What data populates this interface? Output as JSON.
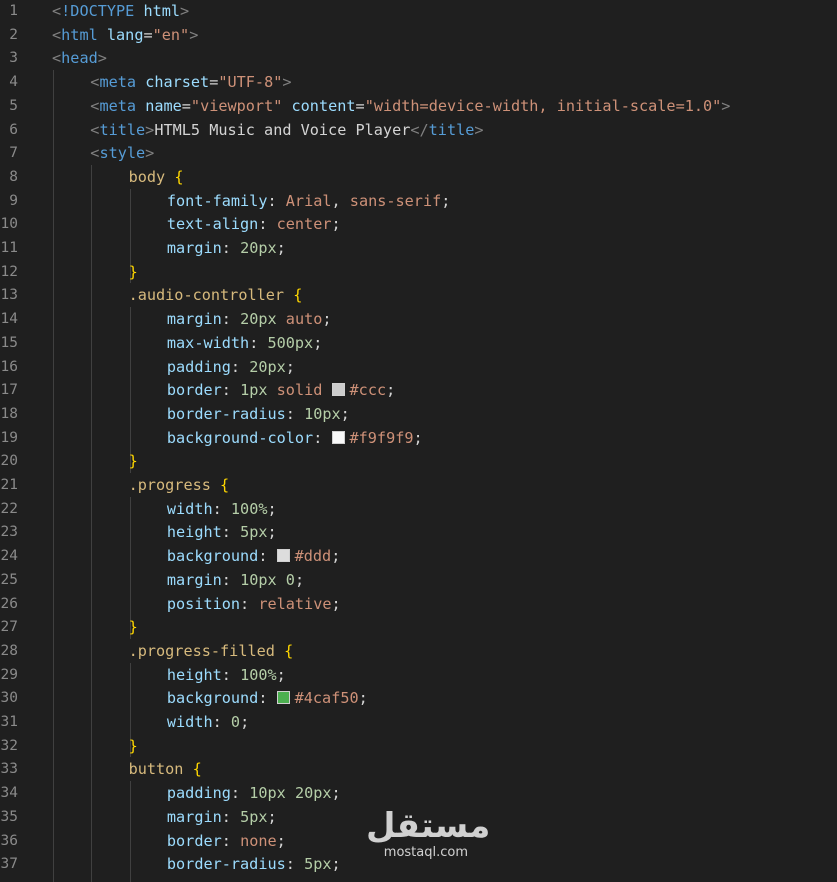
{
  "editor": {
    "line_numbers": [
      "1",
      "2",
      "3",
      "4",
      "5",
      "6",
      "7",
      "8",
      "9",
      "10",
      "11",
      "12",
      "13",
      "14",
      "15",
      "16",
      "17",
      "18",
      "19",
      "20",
      "21",
      "22",
      "23",
      "24",
      "25",
      "26",
      "27",
      "28",
      "29",
      "30",
      "31",
      "32",
      "33",
      "34",
      "35",
      "36",
      "37"
    ],
    "colors": {
      "background": "#1f1f1f",
      "line_number": "#8a8a8a",
      "tag": "#569cd6",
      "attribute": "#9cdcfe",
      "string": "#ce9178",
      "selector": "#d7ba7d",
      "number": "#b5cea8",
      "bracket": "#ffd700"
    },
    "lines": [
      [
        [
          "t-br",
          "<"
        ],
        [
          "t-tag",
          "!DOCTYPE"
        ],
        [
          "t-text",
          " "
        ],
        [
          "t-attr",
          "html"
        ],
        [
          "t-br",
          ">"
        ]
      ],
      [
        [
          "t-br",
          "<"
        ],
        [
          "t-tag",
          "html"
        ],
        [
          "t-text",
          " "
        ],
        [
          "t-attr",
          "lang"
        ],
        [
          "t-punc",
          "="
        ],
        [
          "t-str",
          "\"en\""
        ],
        [
          "t-br",
          ">"
        ]
      ],
      [
        [
          "t-br",
          "<"
        ],
        [
          "t-tag",
          "head"
        ],
        [
          "t-br",
          ">"
        ]
      ],
      [
        [
          "t-br",
          "<"
        ],
        [
          "t-tag",
          "meta"
        ],
        [
          "t-text",
          " "
        ],
        [
          "t-attr",
          "charset"
        ],
        [
          "t-punc",
          "="
        ],
        [
          "t-str",
          "\"UTF-8\""
        ],
        [
          "t-br",
          ">"
        ]
      ],
      [
        [
          "t-br",
          "<"
        ],
        [
          "t-tag",
          "meta"
        ],
        [
          "t-text",
          " "
        ],
        [
          "t-attr",
          "name"
        ],
        [
          "t-punc",
          "="
        ],
        [
          "t-str",
          "\"viewport\""
        ],
        [
          "t-text",
          " "
        ],
        [
          "t-attr",
          "content"
        ],
        [
          "t-punc",
          "="
        ],
        [
          "t-str",
          "\"width=device-width, initial-scale=1.0\""
        ],
        [
          "t-br",
          ">"
        ]
      ],
      [
        [
          "t-br",
          "<"
        ],
        [
          "t-tag",
          "title"
        ],
        [
          "t-br",
          ">"
        ],
        [
          "t-text",
          "HTML5 Music and Voice Player"
        ],
        [
          "t-br",
          "</"
        ],
        [
          "t-tag",
          "title"
        ],
        [
          "t-br",
          ">"
        ]
      ],
      [
        [
          "t-br",
          "<"
        ],
        [
          "t-tag",
          "style"
        ],
        [
          "t-br",
          ">"
        ]
      ],
      [
        [
          "t-sel",
          "body"
        ],
        [
          "t-text",
          " "
        ],
        [
          "t-cur",
          "{"
        ]
      ],
      [
        [
          "t-prop",
          "font-family"
        ],
        [
          "t-punc",
          ": "
        ],
        [
          "t-kw",
          "Arial"
        ],
        [
          "t-punc",
          ", "
        ],
        [
          "t-kw",
          "sans-serif"
        ],
        [
          "t-punc",
          ";"
        ]
      ],
      [
        [
          "t-prop",
          "text-align"
        ],
        [
          "t-punc",
          ": "
        ],
        [
          "t-kw",
          "center"
        ],
        [
          "t-punc",
          ";"
        ]
      ],
      [
        [
          "t-prop",
          "margin"
        ],
        [
          "t-punc",
          ": "
        ],
        [
          "t-num",
          "20px"
        ],
        [
          "t-punc",
          ";"
        ]
      ],
      [
        [
          "t-cur",
          "}"
        ]
      ],
      [
        [
          "t-sel",
          ".audio-controller"
        ],
        [
          "t-text",
          " "
        ],
        [
          "t-cur",
          "{"
        ]
      ],
      [
        [
          "t-prop",
          "margin"
        ],
        [
          "t-punc",
          ": "
        ],
        [
          "t-num",
          "20px"
        ],
        [
          "t-text",
          " "
        ],
        [
          "t-kw",
          "auto"
        ],
        [
          "t-punc",
          ";"
        ]
      ],
      [
        [
          "t-prop",
          "max-width"
        ],
        [
          "t-punc",
          ": "
        ],
        [
          "t-num",
          "500px"
        ],
        [
          "t-punc",
          ";"
        ]
      ],
      [
        [
          "t-prop",
          "padding"
        ],
        [
          "t-punc",
          ": "
        ],
        [
          "t-num",
          "20px"
        ],
        [
          "t-punc",
          ";"
        ]
      ],
      [
        [
          "t-prop",
          "border"
        ],
        [
          "t-punc",
          ": "
        ],
        [
          "t-num",
          "1px"
        ],
        [
          "t-text",
          " "
        ],
        [
          "t-kw",
          "solid"
        ],
        [
          "t-text",
          " "
        ],
        [
          "swatch",
          "#cccccc"
        ],
        [
          "t-kw",
          "#ccc"
        ],
        [
          "t-punc",
          ";"
        ]
      ],
      [
        [
          "t-prop",
          "border-radius"
        ],
        [
          "t-punc",
          ": "
        ],
        [
          "t-num",
          "10px"
        ],
        [
          "t-punc",
          ";"
        ]
      ],
      [
        [
          "t-prop",
          "background-color"
        ],
        [
          "t-punc",
          ": "
        ],
        [
          "swatch",
          "#f9f9f9"
        ],
        [
          "t-kw",
          "#f9f9f9"
        ],
        [
          "t-punc",
          ";"
        ]
      ],
      [
        [
          "t-cur",
          "}"
        ]
      ],
      [
        [
          "t-sel",
          ".progress"
        ],
        [
          "t-text",
          " "
        ],
        [
          "t-cur",
          "{"
        ]
      ],
      [
        [
          "t-prop",
          "width"
        ],
        [
          "t-punc",
          ": "
        ],
        [
          "t-num",
          "100%"
        ],
        [
          "t-punc",
          ";"
        ]
      ],
      [
        [
          "t-prop",
          "height"
        ],
        [
          "t-punc",
          ": "
        ],
        [
          "t-num",
          "5px"
        ],
        [
          "t-punc",
          ";"
        ]
      ],
      [
        [
          "t-prop",
          "background"
        ],
        [
          "t-punc",
          ": "
        ],
        [
          "swatch",
          "#dddddd"
        ],
        [
          "t-kw",
          "#ddd"
        ],
        [
          "t-punc",
          ";"
        ]
      ],
      [
        [
          "t-prop",
          "margin"
        ],
        [
          "t-punc",
          ": "
        ],
        [
          "t-num",
          "10px"
        ],
        [
          "t-text",
          " "
        ],
        [
          "t-num",
          "0"
        ],
        [
          "t-punc",
          ";"
        ]
      ],
      [
        [
          "t-prop",
          "position"
        ],
        [
          "t-punc",
          ": "
        ],
        [
          "t-kw",
          "relative"
        ],
        [
          "t-punc",
          ";"
        ]
      ],
      [
        [
          "t-cur",
          "}"
        ]
      ],
      [
        [
          "t-sel",
          ".progress-filled"
        ],
        [
          "t-text",
          " "
        ],
        [
          "t-cur",
          "{"
        ]
      ],
      [
        [
          "t-prop",
          "height"
        ],
        [
          "t-punc",
          ": "
        ],
        [
          "t-num",
          "100%"
        ],
        [
          "t-punc",
          ";"
        ]
      ],
      [
        [
          "t-prop",
          "background"
        ],
        [
          "t-punc",
          ": "
        ],
        [
          "swatch",
          "#4caf50"
        ],
        [
          "t-kw",
          "#4caf50"
        ],
        [
          "t-punc",
          ";"
        ]
      ],
      [
        [
          "t-prop",
          "width"
        ],
        [
          "t-punc",
          ": "
        ],
        [
          "t-num",
          "0"
        ],
        [
          "t-punc",
          ";"
        ]
      ],
      [
        [
          "t-cur",
          "}"
        ]
      ],
      [
        [
          "t-sel",
          "button"
        ],
        [
          "t-text",
          " "
        ],
        [
          "t-cur",
          "{"
        ]
      ],
      [
        [
          "t-prop",
          "padding"
        ],
        [
          "t-punc",
          ": "
        ],
        [
          "t-num",
          "10px"
        ],
        [
          "t-text",
          " "
        ],
        [
          "t-num",
          "20px"
        ],
        [
          "t-punc",
          ";"
        ]
      ],
      [
        [
          "t-prop",
          "margin"
        ],
        [
          "t-punc",
          ": "
        ],
        [
          "t-num",
          "5px"
        ],
        [
          "t-punc",
          ";"
        ]
      ],
      [
        [
          "t-prop",
          "border"
        ],
        [
          "t-punc",
          ": "
        ],
        [
          "t-kw",
          "none"
        ],
        [
          "t-punc",
          ";"
        ]
      ],
      [
        [
          "t-prop",
          "border-radius"
        ],
        [
          "t-punc",
          ": "
        ],
        [
          "t-num",
          "5px"
        ],
        [
          "t-punc",
          ";"
        ]
      ]
    ]
  },
  "watermark": {
    "arabic": "مستقل",
    "latin": "mostaql.com"
  }
}
